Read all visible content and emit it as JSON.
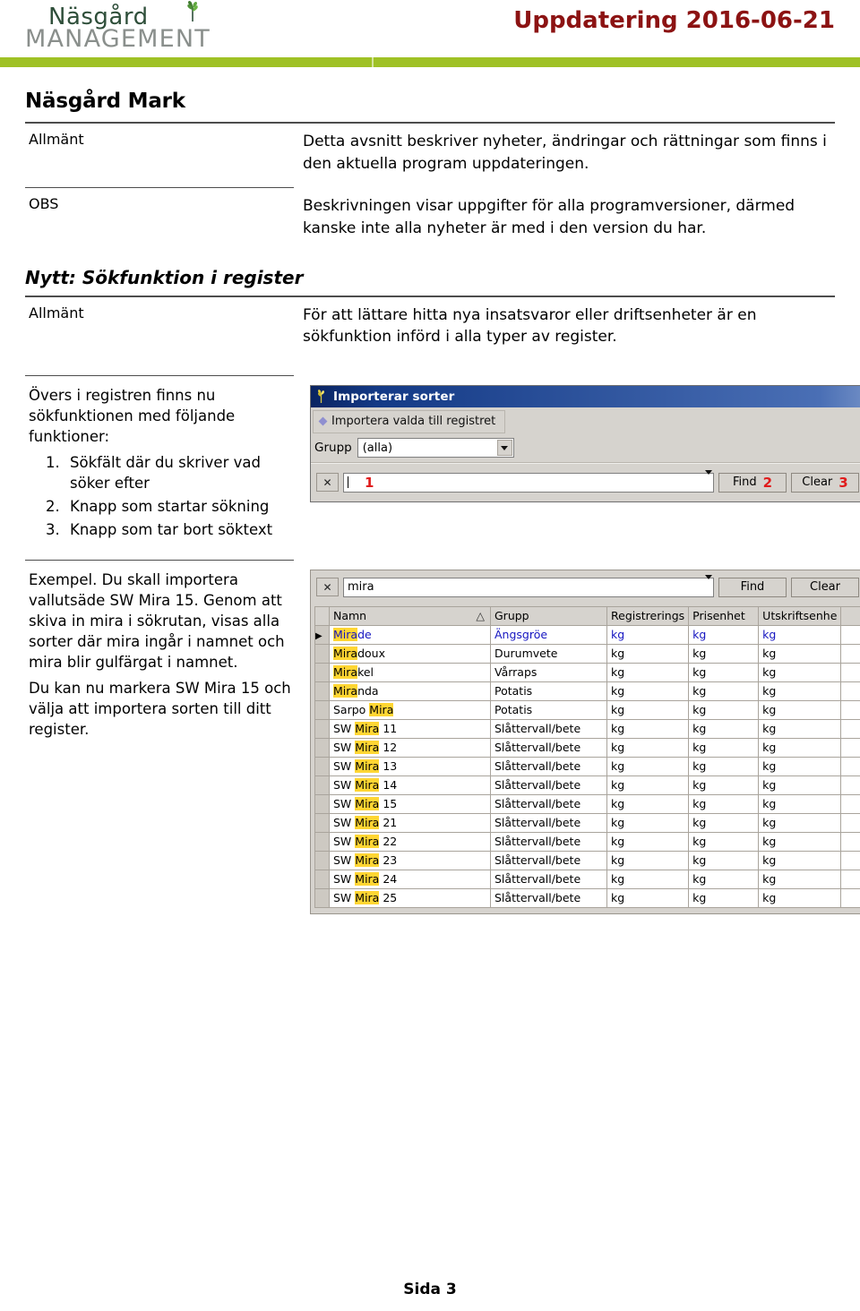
{
  "header": {
    "logo_line1": "Näsgård",
    "logo_line2": "MANAGEMENT",
    "doc_title": "Uppdatering 2016-06-21",
    "accent_green": "#9fc125",
    "title_red": "#8c1313"
  },
  "sections": {
    "h1": "Näsgård Mark",
    "row1": {
      "label": "Allmänt",
      "text": "Detta avsnitt beskriver nyheter, ändringar och rättningar som finns i den aktuella program uppdateringen."
    },
    "row2": {
      "label": "OBS",
      "text": "Beskrivningen visar uppgifter för alla programversioner, därmed kanske inte alla nyheter är med i den version du har."
    },
    "h2": "Nytt: Sökfunktion i register",
    "row3": {
      "label": "Allmänt",
      "text": "För att lättare hitta nya insatsvaror eller driftsenheter är en sökfunktion införd i alla typer av register."
    }
  },
  "block1": {
    "intro": "Övers i registren finns nu sökfunktionen med följande funktioner:",
    "steps": [
      "Sökfält där du skriver vad söker efter",
      "Knapp som startar sökning",
      "Knapp som tar bort söktext"
    ]
  },
  "block2": {
    "paragraphs": [
      "Exempel. Du skall importera vallutsäde SW Mira 15. Genom att skiva in mira i sökrutan, visas alla sorter där mira ingår i namnet och mira blir gulfärgat i namnet.",
      "Du kan nu markera SW Mira 15 och välja att importera sorten till ditt register."
    ]
  },
  "screenshot1": {
    "window_title": "Importerar sorter",
    "toolbar_button": "Importera valda till registret",
    "grupp_label": "Grupp",
    "grupp_value": "(alla)",
    "close_x": "✕",
    "search_value": "",
    "marker1": "1",
    "find_label": "Find",
    "marker2": "2",
    "clear_label": "Clear",
    "marker3": "3"
  },
  "screenshot2": {
    "close_x": "✕",
    "search_value": "mira",
    "find_label": "Find",
    "clear_label": "Clear",
    "sort_indicator": "△",
    "row_indicator": "▶",
    "columns": [
      "Namn",
      "Grupp",
      "Registrerings",
      "Prisenhet",
      "Utskriftsenhe"
    ],
    "highlight_term": "Mira",
    "rows": [
      {
        "namn_pre": "",
        "namn_hl": "Mira",
        "namn_post": "de",
        "grupp": "Ängsgröe",
        "reg": "kg",
        "pris": "kg",
        "utskr": "kg",
        "selected": true
      },
      {
        "namn_pre": "",
        "namn_hl": "Mira",
        "namn_post": "doux",
        "grupp": "Durumvete",
        "reg": "kg",
        "pris": "kg",
        "utskr": "kg",
        "selected": false
      },
      {
        "namn_pre": "",
        "namn_hl": "Mira",
        "namn_post": "kel",
        "grupp": "Vårraps",
        "reg": "kg",
        "pris": "kg",
        "utskr": "kg",
        "selected": false
      },
      {
        "namn_pre": "",
        "namn_hl": "Mira",
        "namn_post": "nda",
        "grupp": "Potatis",
        "reg": "kg",
        "pris": "kg",
        "utskr": "kg",
        "selected": false
      },
      {
        "namn_pre": "Sarpo ",
        "namn_hl": "Mira",
        "namn_post": "",
        "grupp": "Potatis",
        "reg": "kg",
        "pris": "kg",
        "utskr": "kg",
        "selected": false
      },
      {
        "namn_pre": "SW ",
        "namn_hl": "Mira",
        "namn_post": " 11",
        "grupp": "Slåttervall/bete",
        "reg": "kg",
        "pris": "kg",
        "utskr": "kg",
        "selected": false
      },
      {
        "namn_pre": "SW ",
        "namn_hl": "Mira",
        "namn_post": " 12",
        "grupp": "Slåttervall/bete",
        "reg": "kg",
        "pris": "kg",
        "utskr": "kg",
        "selected": false
      },
      {
        "namn_pre": "SW ",
        "namn_hl": "Mira",
        "namn_post": " 13",
        "grupp": "Slåttervall/bete",
        "reg": "kg",
        "pris": "kg",
        "utskr": "kg",
        "selected": false
      },
      {
        "namn_pre": "SW ",
        "namn_hl": "Mira",
        "namn_post": " 14",
        "grupp": "Slåttervall/bete",
        "reg": "kg",
        "pris": "kg",
        "utskr": "kg",
        "selected": false
      },
      {
        "namn_pre": "SW ",
        "namn_hl": "Mira",
        "namn_post": " 15",
        "grupp": "Slåttervall/bete",
        "reg": "kg",
        "pris": "kg",
        "utskr": "kg",
        "selected": false
      },
      {
        "namn_pre": "SW ",
        "namn_hl": "Mira",
        "namn_post": " 21",
        "grupp": "Slåttervall/bete",
        "reg": "kg",
        "pris": "kg",
        "utskr": "kg",
        "selected": false
      },
      {
        "namn_pre": "SW ",
        "namn_hl": "Mira",
        "namn_post": " 22",
        "grupp": "Slåttervall/bete",
        "reg": "kg",
        "pris": "kg",
        "utskr": "kg",
        "selected": false
      },
      {
        "namn_pre": "SW ",
        "namn_hl": "Mira",
        "namn_post": " 23",
        "grupp": "Slåttervall/bete",
        "reg": "kg",
        "pris": "kg",
        "utskr": "kg",
        "selected": false
      },
      {
        "namn_pre": "SW ",
        "namn_hl": "Mira",
        "namn_post": " 24",
        "grupp": "Slåttervall/bete",
        "reg": "kg",
        "pris": "kg",
        "utskr": "kg",
        "selected": false
      },
      {
        "namn_pre": "SW ",
        "namn_hl": "Mira",
        "namn_post": " 25",
        "grupp": "Slåttervall/bete",
        "reg": "kg",
        "pris": "kg",
        "utskr": "kg",
        "selected": false
      }
    ]
  },
  "footer": {
    "page_label": "Sida 3"
  }
}
